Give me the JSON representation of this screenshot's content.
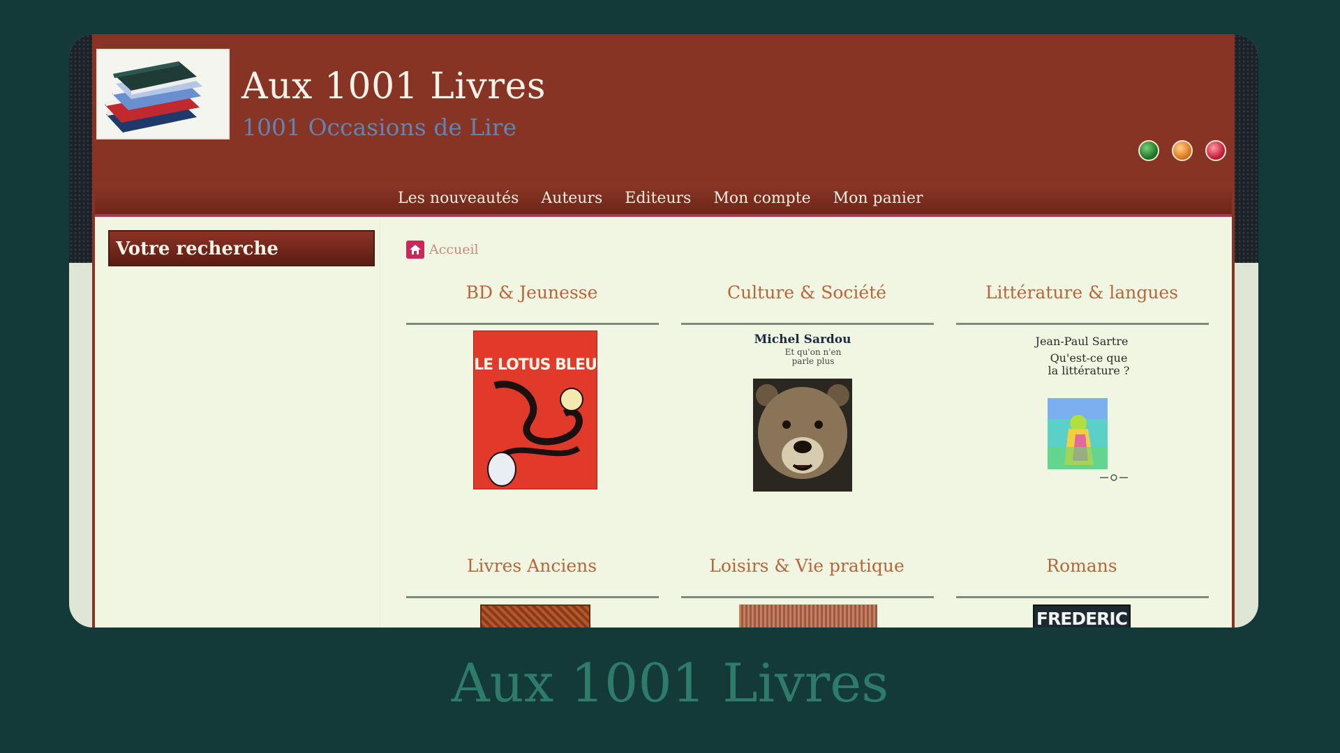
{
  "site": {
    "title": "Aux 1001 Livres",
    "subtitle": "1001 Occasions de Lire"
  },
  "header_dots": [
    "green-dot",
    "orange-dot",
    "red-dot"
  ],
  "nav": {
    "items": [
      "Les nouveautés",
      "Auteurs",
      "Editeurs",
      "Mon compte",
      "Mon panier"
    ]
  },
  "sidebar": {
    "search_title": "Votre recherche"
  },
  "breadcrumb": {
    "label": "Accueil"
  },
  "categories": [
    {
      "title": "BD & Jeunesse",
      "cover": {
        "title": "LE LOTUS BLEU"
      }
    },
    {
      "title": "Culture & Société",
      "cover": {
        "author": "Michel Sardou",
        "subtitle": "Et qu'on n'en parle plus"
      }
    },
    {
      "title": "Littérature & langues",
      "cover": {
        "author": "Jean-Paul Sartre",
        "title": "Qu'est-ce que la littérature ?"
      }
    },
    {
      "title": "Livres Anciens"
    },
    {
      "title": "Loisirs & Vie pratique"
    },
    {
      "title": "Romans",
      "cover": {
        "title": "FREDERIC"
      }
    }
  ],
  "page_caption": "Aux 1001 Livres",
  "colors": {
    "page_background": "#133a38",
    "header": "#873424",
    "content_background": "#f1f6e3",
    "category_title": "#b8653a",
    "caption": "#2e7a6b"
  }
}
